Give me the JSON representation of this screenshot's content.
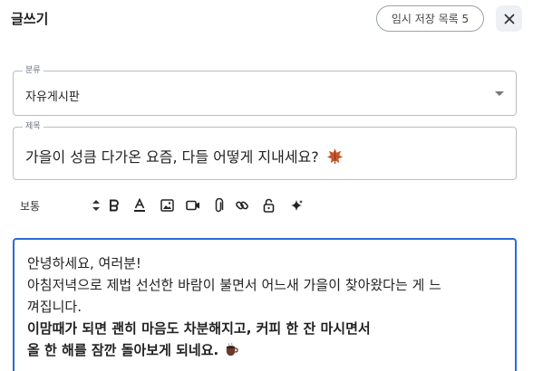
{
  "header": {
    "title": "글쓰기",
    "drafts_button": "임시 저장 목록 5",
    "close_icon": "close-icon"
  },
  "category": {
    "label": "분류",
    "value": "자유게시판"
  },
  "subject": {
    "label": "제목",
    "value": "가을이 성큼 다가온 요즘, 다들 어떻게 지내세요?",
    "emoji_icon": "maple-leaf-icon"
  },
  "toolbar": {
    "font_size": "보통",
    "tools": [
      "bold-icon",
      "text-color-icon",
      "image-icon",
      "video-icon",
      "attachment-icon",
      "link-icon",
      "lock-icon",
      "ai-sparkle-icon"
    ]
  },
  "editor": {
    "lines": [
      "안녕하세요, 여러분!",
      "아침저녁으로 제법 선선한 바람이 불면서 어느새 가을이 찾아왔다는 게 느",
      "껴집니다.",
      "이맘때가 되면 괜히 마음도 차분해지고, 커피 한 잔 마시면서",
      "올 한 해를 잠깐 돌아보게 되네요."
    ],
    "emoji_icon": "coffee-cup-icon"
  },
  "colors": {
    "focus_border": "#2a6ad8",
    "field_border": "#b9bec6",
    "close_bg": "#eef0f4"
  }
}
